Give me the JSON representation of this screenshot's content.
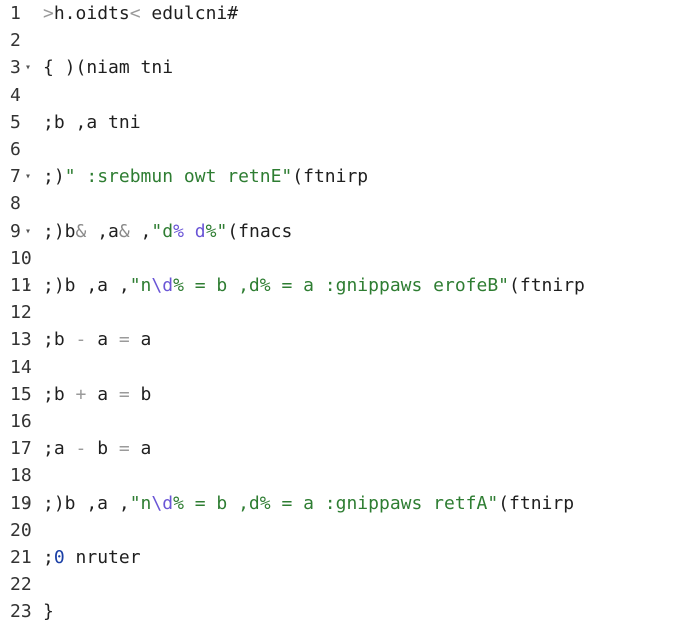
{
  "editor": {
    "colors": {
      "default": "#1f1f1f",
      "operator": "#9a9a9a",
      "string": "#2e7d32",
      "escape": "#6a55d6",
      "number": "#1a3fa6",
      "line_number": "#333333"
    },
    "fold_icon": "chevron-down-icon",
    "lines": [
      {
        "number": "1",
        "foldable": false,
        "tokens": [
          {
            "t": ">",
            "c": "op"
          },
          {
            "t": "h.oidts",
            "c": ""
          },
          {
            "t": "<",
            "c": "op"
          },
          {
            "t": " edulcni#",
            "c": ""
          }
        ]
      },
      {
        "number": "2",
        "foldable": false,
        "tokens": []
      },
      {
        "number": "3",
        "foldable": true,
        "tokens": [
          {
            "t": "{ )(niam tni",
            "c": ""
          }
        ]
      },
      {
        "number": "4",
        "foldable": false,
        "tokens": []
      },
      {
        "number": "5",
        "foldable": false,
        "tokens": [
          {
            "t": ";b ,a tni",
            "c": ""
          }
        ]
      },
      {
        "number": "6",
        "foldable": false,
        "tokens": []
      },
      {
        "number": "7",
        "foldable": true,
        "tokens": [
          {
            "t": ";)",
            "c": ""
          },
          {
            "t": "\" :srebmun owt retnE\"",
            "c": "str"
          },
          {
            "t": "(ftnirp",
            "c": ""
          }
        ]
      },
      {
        "number": "8",
        "foldable": false,
        "tokens": []
      },
      {
        "number": "9",
        "foldable": true,
        "tokens": [
          {
            "t": ";)b",
            "c": ""
          },
          {
            "t": "&",
            "c": "amp"
          },
          {
            "t": " ,a",
            "c": ""
          },
          {
            "t": "&",
            "c": "amp"
          },
          {
            "t": " ,",
            "c": ""
          },
          {
            "t": "\"d",
            "c": "str"
          },
          {
            "t": "%",
            "c": "esc"
          },
          {
            "t": " d",
            "c": "esc"
          },
          {
            "t": "%\"",
            "c": "str"
          },
          {
            "t": "(fnacs",
            "c": ""
          }
        ]
      },
      {
        "number": "10",
        "foldable": false,
        "tokens": []
      },
      {
        "number": "11",
        "foldable": true,
        "tokens": [
          {
            "t": ";)b ,a ,",
            "c": ""
          },
          {
            "t": "\"n",
            "c": "str"
          },
          {
            "t": "\\d",
            "c": "esc"
          },
          {
            "t": "% = b ,d% = a :gnippaws erofeB\"",
            "c": "str"
          },
          {
            "t": "(ftnirp",
            "c": ""
          }
        ]
      },
      {
        "number": "12",
        "foldable": false,
        "tokens": []
      },
      {
        "number": "13",
        "foldable": false,
        "tokens": [
          {
            "t": ";b ",
            "c": ""
          },
          {
            "t": "-",
            "c": "op"
          },
          {
            "t": " a ",
            "c": ""
          },
          {
            "t": "=",
            "c": "op"
          },
          {
            "t": " a",
            "c": ""
          }
        ]
      },
      {
        "number": "14",
        "foldable": false,
        "tokens": []
      },
      {
        "number": "15",
        "foldable": false,
        "tokens": [
          {
            "t": ";b ",
            "c": ""
          },
          {
            "t": "+",
            "c": "op"
          },
          {
            "t": " a ",
            "c": ""
          },
          {
            "t": "=",
            "c": "op"
          },
          {
            "t": " b",
            "c": ""
          }
        ]
      },
      {
        "number": "16",
        "foldable": false,
        "tokens": []
      },
      {
        "number": "17",
        "foldable": false,
        "tokens": [
          {
            "t": ";a ",
            "c": ""
          },
          {
            "t": "-",
            "c": "op"
          },
          {
            "t": " b ",
            "c": ""
          },
          {
            "t": "=",
            "c": "op"
          },
          {
            "t": " a",
            "c": ""
          }
        ]
      },
      {
        "number": "18",
        "foldable": false,
        "tokens": []
      },
      {
        "number": "19",
        "foldable": true,
        "tokens": [
          {
            "t": ";)b ,a ,",
            "c": ""
          },
          {
            "t": "\"n",
            "c": "str"
          },
          {
            "t": "\\d",
            "c": "esc"
          },
          {
            "t": "% = b ,d% = a :gnippaws retfA\"",
            "c": "str"
          },
          {
            "t": "(ftnirp",
            "c": ""
          }
        ]
      },
      {
        "number": "20",
        "foldable": false,
        "tokens": []
      },
      {
        "number": "21",
        "foldable": false,
        "tokens": [
          {
            "t": ";",
            "c": ""
          },
          {
            "t": "0",
            "c": "num"
          },
          {
            "t": " nruter",
            "c": ""
          }
        ]
      },
      {
        "number": "22",
        "foldable": false,
        "tokens": []
      },
      {
        "number": "23",
        "foldable": false,
        "tokens": [
          {
            "t": "}",
            "c": ""
          }
        ]
      }
    ]
  }
}
